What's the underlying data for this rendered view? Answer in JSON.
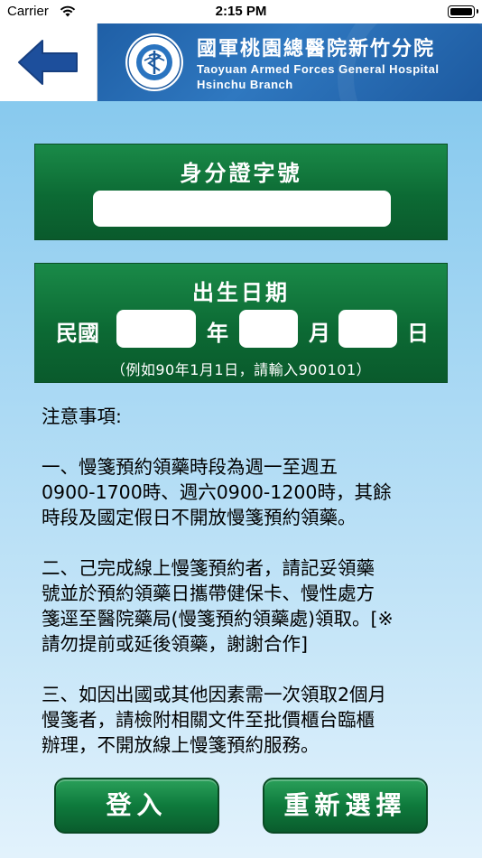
{
  "status_bar": {
    "carrier": "Carrier",
    "time": "2:15 PM"
  },
  "header": {
    "hospital_name_zh": "國軍桃園總醫院新竹分院",
    "hospital_name_en_line1": "Taoyuan Armed Forces General Hospital",
    "hospital_name_en_line2": "Hsinchu Branch"
  },
  "id_section": {
    "title": "身分證字號",
    "value": ""
  },
  "birth_section": {
    "title": "出生日期",
    "era_label": "民國",
    "year_label": "年",
    "month_label": "月",
    "day_label": "日",
    "year_value": "",
    "month_value": "",
    "day_value": "",
    "example": "（例如90年1月1日，請輸入900101）"
  },
  "notes": {
    "heading": "注意事項:",
    "items": [
      "一、慢箋預約領藥時段為週一至週五\n0900-1700時、週六0900-1200時，其餘\n時段及國定假日不開放慢箋預約領藥。",
      "二、己完成線上慢箋預約者，請記妥領藥\n號並於預約領藥日攜帶健保卡、慢性處方\n箋逕至醫院藥局(慢箋預約領藥處)領取。[※\n請勿提前或延後領藥，謝謝合作]",
      "三、如因出國或其他因素需一次領取2個月\n慢箋者，請檢附相關文件至批價櫃台臨櫃\n辦理，不開放線上慢箋預約服務。"
    ]
  },
  "buttons": {
    "login": "登入",
    "reset": "重新選擇"
  },
  "colors": {
    "panel_green": "#0c6a34",
    "banner_blue": "#1f5fa6",
    "back_arrow": "#1d4f9c"
  }
}
